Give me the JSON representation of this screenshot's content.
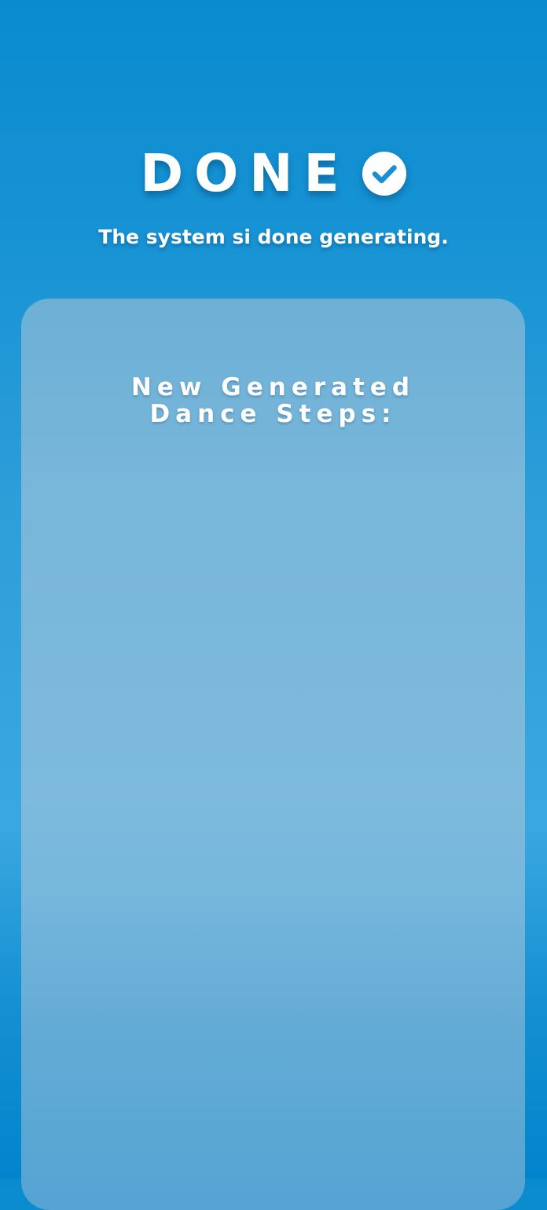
{
  "header": {
    "title": "DONE",
    "icon": "check-circle-icon",
    "subtitle": "The system si done generating."
  },
  "card": {
    "heading_line1": "New Generated",
    "heading_line2": "Dance Steps:"
  },
  "colors": {
    "background_top": "#0a8bd0",
    "background_bottom": "#0284cc",
    "card": "#7dbadd",
    "text": "#ffffff",
    "check_mark": "#1a8fd1"
  }
}
